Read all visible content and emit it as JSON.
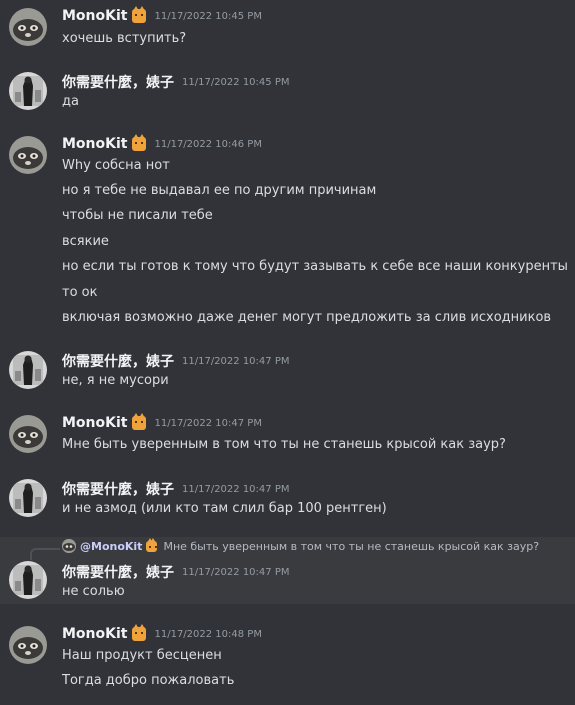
{
  "users": {
    "monokit": "MonoKit",
    "other": "你需要什麼，婊子"
  },
  "messages": [
    {
      "author": "MonoKit",
      "badge": "cat-face-icon",
      "time": "11/17/2022 10:45 PM",
      "lines": [
        "хочешь вступить?"
      ]
    },
    {
      "author": "你需要什麼，婊子",
      "time": "11/17/2022 10:45 PM",
      "lines": [
        "да"
      ]
    },
    {
      "author": "MonoKit",
      "badge": "cat-face-icon",
      "time": "11/17/2022 10:46 PM",
      "lines": [
        "Why собсна нот",
        "но я тебе не выдавал ее по другим причинам",
        "чтобы не писали тебе",
        "всякие",
        "но если ты готов к тому что будут зазывать к себе все наши конкуренты",
        "то ок",
        "включая возможно даже денег могут предложить за слив исходников"
      ]
    },
    {
      "author": "你需要什麼，婊子",
      "time": "11/17/2022 10:47 PM",
      "lines": [
        "не, я не мусори"
      ]
    },
    {
      "author": "MonoKit",
      "badge": "cat-face-icon",
      "time": "11/17/2022 10:47 PM",
      "lines": [
        "Мне быть уверенным в том что ты не станешь крысой как заур?"
      ]
    },
    {
      "author": "你需要什麼，婊子",
      "time": "11/17/2022 10:47 PM",
      "lines": [
        "и не азмод (или кто там слил бар 100 рентген)"
      ]
    },
    {
      "author": "你需要什麼，婊子",
      "time": "11/17/2022 10:47 PM",
      "lines": [
        "не солью"
      ],
      "reply": {
        "mention": "@MonoKit",
        "text": "Мне быть уверенным в том что ты не станешь крысой как заур?"
      }
    },
    {
      "author": "MonoKit",
      "badge": "cat-face-icon",
      "time": "11/17/2022 10:48 PM",
      "lines": [
        "Наш продукт бесценен",
        "Тогда добро пожаловать"
      ]
    }
  ]
}
